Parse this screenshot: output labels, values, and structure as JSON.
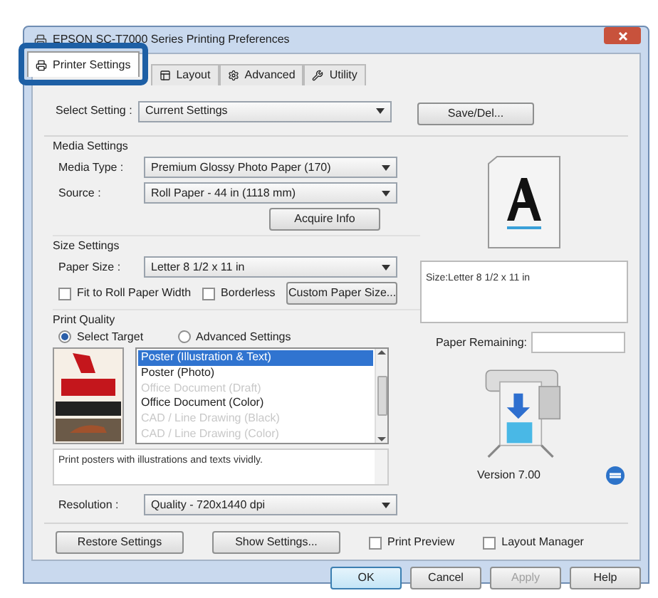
{
  "window": {
    "title": "EPSON SC-T7000 Series Printing Preferences"
  },
  "tabs": [
    {
      "label": "Printer Settings",
      "selected": true
    },
    {
      "label": "Layout",
      "selected": false
    },
    {
      "label": "Advanced",
      "selected": false
    },
    {
      "label": "Utility",
      "selected": false
    }
  ],
  "select_setting": {
    "label": "Select Setting :",
    "value": "Current Settings",
    "button": "Save/Del..."
  },
  "media_settings": {
    "title": "Media Settings",
    "media_type": {
      "label": "Media Type :",
      "value": "Premium Glossy Photo Paper (170)"
    },
    "source": {
      "label": "Source :",
      "value": "Roll Paper - 44 in (1118 mm)"
    },
    "acquire_button": "Acquire Info"
  },
  "size_settings": {
    "title": "Size Settings",
    "paper_size": {
      "label": "Paper Size :",
      "value": "Letter 8 1/2 x 11 in"
    },
    "checkboxes": [
      {
        "label": "Fit to Roll Paper Width",
        "checked": false
      },
      {
        "label": "Borderless",
        "checked": false
      }
    ],
    "custom_button": "Custom Paper Size..."
  },
  "size_info": "Size:Letter 8 1/2 x 11 in",
  "print_quality": {
    "title": "Print Quality",
    "radios": [
      {
        "label": "Select Target",
        "selected": true
      },
      {
        "label": "Advanced Settings",
        "selected": false
      }
    ],
    "targets": [
      {
        "label": "Poster (Illustration & Text)",
        "selected": true,
        "disabled": false
      },
      {
        "label": "Poster (Photo)",
        "selected": false,
        "disabled": false
      },
      {
        "label": "Office Document (Draft)",
        "selected": false,
        "disabled": true
      },
      {
        "label": "Office Document (Color)",
        "selected": false,
        "disabled": false
      },
      {
        "label": "CAD / Line Drawing (Black)",
        "selected": false,
        "disabled": true
      },
      {
        "label": "CAD / Line Drawing (Color)",
        "selected": false,
        "disabled": true
      }
    ],
    "description": "Print posters with illustrations and texts vividly.",
    "resolution": {
      "label": "Resolution :",
      "value": "Quality - 720x1440 dpi"
    }
  },
  "paper_remaining": {
    "label": "Paper Remaining:"
  },
  "version": "Version 7.00",
  "action_buttons": [
    "Restore Settings",
    "Show Settings..."
  ],
  "options": [
    {
      "label": "Print Preview",
      "checked": false
    },
    {
      "label": "Layout Manager",
      "checked": false
    }
  ],
  "dialog_buttons": [
    {
      "label": "OK",
      "disabled": false
    },
    {
      "label": "Cancel",
      "disabled": false
    },
    {
      "label": "Apply",
      "disabled": true
    },
    {
      "label": "Help",
      "disabled": false
    }
  ]
}
